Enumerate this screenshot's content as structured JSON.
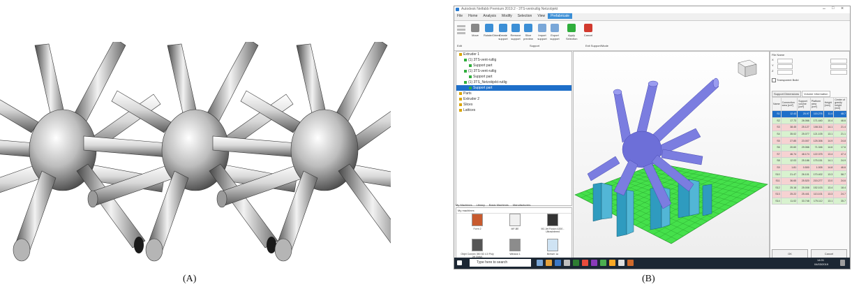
{
  "captions": {
    "a": "(A)",
    "b": "(B)"
  },
  "window": {
    "title": "Autodesk Netfabb Premium 2019.2 - 3TS-ventrutlig Netzobjekt"
  },
  "menu": [
    "File",
    "Home",
    "Analysis",
    "Modify",
    "Selection",
    "View",
    "Prefabricate"
  ],
  "menu_active_index": 6,
  "ribbon": {
    "buttons": [
      "Move",
      "Rotate/Orient",
      "Create support",
      "Remove support",
      "Slice preview",
      "Import support",
      "Export support",
      "Apply Selection",
      "Cancel"
    ],
    "groups": [
      "Edit",
      "Support",
      "Exit Support/Mode"
    ]
  },
  "tree": [
    {
      "label": "Extruder 1",
      "indent": 0,
      "selected": false
    },
    {
      "label": "(1) 3TS-vent-rutlig",
      "indent": 1,
      "selected": false
    },
    {
      "label": "Support part",
      "indent": 2,
      "selected": false
    },
    {
      "label": "(1) 3TS-vent-rutlig",
      "indent": 1,
      "selected": false
    },
    {
      "label": "Support part",
      "indent": 2,
      "selected": false
    },
    {
      "label": "(1) 3TS_Netzobjekt-rutlig",
      "indent": 1,
      "selected": false
    },
    {
      "label": "Support part",
      "indent": 2,
      "selected": true
    },
    {
      "label": "Parts",
      "indent": 0,
      "selected": false
    },
    {
      "label": "Extruder 2",
      "indent": 0,
      "selected": false
    },
    {
      "label": "Slices",
      "indent": 0,
      "selected": false
    },
    {
      "label": "Lattices",
      "indent": 0,
      "selected": false
    }
  ],
  "library_tabs": [
    "My Machines",
    "Library",
    "Basic Machines",
    "Manufacturers"
  ],
  "library_header": "My machines",
  "library_items": [
    "Form 2",
    "MF-BE",
    "M1 Jet Fusion 4200 - Ultrasintered",
    "Objet Connex 350 3D 4.0 Poly Jet (beta)",
    "Window 1",
    "Brewer 1a"
  ],
  "taskbar": {
    "search_placeholder": "Type here to search",
    "clock_time": "14:01",
    "clock_date": "04/03/2019"
  },
  "props": {
    "header": "File Name",
    "fields": [
      {
        "label": "X"
      },
      {
        "label": "Y"
      },
      {
        "label": "Z"
      }
    ],
    "checkbox_label": "Transparent Build",
    "tabs": [
      "Support Dimensions",
      "Volume Information"
    ],
    "columns": [
      "Name",
      "Connection area [cm²]",
      "Support volume [cm³]",
      "Platform area [cm²]",
      "Height [mm]",
      "Center of gravity height [mm]"
    ],
    "rows": [
      [
        "S1",
        "12.43",
        "25.97",
        "115.276",
        "11.4",
        "48.7"
      ],
      [
        "S2",
        "17.73",
        "26.066",
        "171.440",
        "10.4",
        "46.6"
      ],
      [
        "S3",
        "38.45",
        "25.127",
        "108.311",
        "14.1",
        "21.4"
      ],
      [
        "S4",
        "35.02",
        "25.077",
        "121.105",
        "13.1",
        "21.1"
      ],
      [
        "S5",
        "27.85",
        "23.007",
        "125.306",
        "14.9",
        "24.8"
      ],
      [
        "S6",
        "20.60",
        "29.066",
        "71.346",
        "14.6",
        "17.6"
      ],
      [
        "S7",
        "46.74",
        "48.174",
        "122.375",
        "13.4",
        "47.4"
      ],
      [
        "S8",
        "12.03",
        "25.186",
        "175.151",
        "14.1",
        "24.9"
      ],
      [
        "S9",
        "1.81",
        "0.500",
        "1.005",
        "14.8",
        "46.6"
      ],
      [
        "S10",
        "21.47",
        "26.101",
        "170.402",
        "13.3",
        "58.7"
      ],
      [
        "S11",
        "36.65",
        "25.520",
        "215.277",
        "13.0",
        "24.6"
      ],
      [
        "S12",
        "25.18",
        "25.008",
        "152.103",
        "13.4",
        "18.4"
      ],
      [
        "S13",
        "25.22",
        "25.441",
        "113.101",
        "13.3",
        "24.7"
      ],
      [
        "S14",
        "11.02",
        "33.748",
        "175.112",
        "13.1",
        "35.7"
      ]
    ],
    "row_status": [
      "sel",
      "g",
      "r",
      "g",
      "r",
      "g",
      "r",
      "g",
      "r",
      "g",
      "r",
      "g",
      "r",
      "g"
    ],
    "ok_label": "OK",
    "cancel_label": "Cancel"
  },
  "colors": {
    "model": "#7b7de0",
    "support": "#2f9bbf",
    "platform": "#45e04b",
    "grid_line": "#1f8c24",
    "selection": "#1e6fc9",
    "row_green": "#d8f2cf",
    "row_red": "#f6d2d2"
  }
}
